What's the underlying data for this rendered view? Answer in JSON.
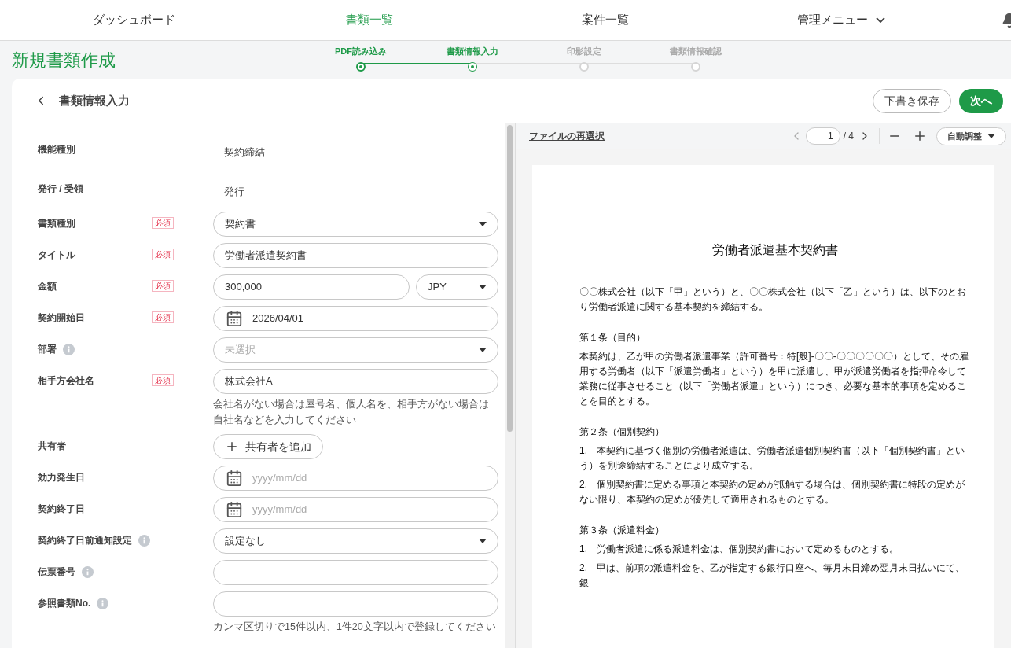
{
  "nav": {
    "items": [
      {
        "label": "ダッシュボード",
        "selected": false,
        "menu": false
      },
      {
        "label": "書類一覧",
        "selected": true,
        "menu": false
      },
      {
        "label": "案件一覧",
        "selected": false,
        "menu": false
      },
      {
        "label": "管理メニュー",
        "selected": false,
        "menu": true
      }
    ]
  },
  "page_title": "新規書類作成",
  "steps": [
    {
      "label": "PDF読み込み",
      "done": true,
      "selected": false
    },
    {
      "label": "書類情報入力",
      "done": false,
      "selected": true
    },
    {
      "label": "印影設定",
      "done": false,
      "selected": false
    },
    {
      "label": "書類情報確認",
      "done": false,
      "selected": false
    }
  ],
  "card": {
    "title": "書類情報入力",
    "buttons": [
      {
        "label": "下書き保存",
        "kind": "outline"
      },
      {
        "label": "次へ",
        "kind": "primary"
      }
    ]
  },
  "form": [
    {
      "kind": "static",
      "label": "機能種別",
      "info": false,
      "value": "契約締結"
    },
    {
      "kind": "static",
      "label": "発行 / 受領",
      "info": false,
      "value": "発行"
    },
    {
      "kind": "select",
      "label": "書類種別",
      "required_badge": "必須",
      "info": false,
      "value": "契約書"
    },
    {
      "kind": "text",
      "label": "タイトル",
      "required_badge": "必須",
      "info": false,
      "value": "労働者派遣契約書"
    },
    {
      "kind": "amount",
      "label": "金額",
      "required_badge": "必須",
      "info": false,
      "value": "300,000",
      "currency": "JPY"
    },
    {
      "kind": "date",
      "label": "契約開始日",
      "required_badge": "必須",
      "info": false,
      "value": "2026/04/01"
    },
    {
      "kind": "select",
      "label": "部署",
      "info": true,
      "placeholder": "未選択"
    },
    {
      "kind": "text",
      "label": "相手方会社名",
      "required_badge": "必須",
      "info": false,
      "value": "株式会社A",
      "note": "会社名がない場合は屋号名、個人名を、相手方がない場合は自社名などを入力してください"
    },
    {
      "kind": "button",
      "label": "共有者",
      "info": false,
      "button": "共有者を追加"
    },
    {
      "kind": "date",
      "label": "効力発生日",
      "info": false,
      "placeholder": "yyyy/mm/dd"
    },
    {
      "kind": "date",
      "label": "契約終了日",
      "info": false,
      "placeholder": "yyyy/mm/dd"
    },
    {
      "kind": "select",
      "label": "契約終了日前通知設定",
      "info": true,
      "value": "設定なし"
    },
    {
      "kind": "text",
      "label": "伝票番号",
      "info": true
    },
    {
      "kind": "text",
      "label": "参照書類No.",
      "info": true,
      "note": "カンマ区切りで15件以内、1件20文字以内で登録してください"
    }
  ],
  "viewer": {
    "reselect": "ファイルの再選択",
    "page": "1",
    "total": "/ 4",
    "zoom": "自動調整",
    "document": [
      {
        "kind": "title",
        "text": "労働者派遣基本契約書"
      },
      {
        "kind": "para",
        "text": "〇〇株式会社（以下「甲」という）と、〇〇株式会社（以下「乙」という）は、以下のとおり労働者派遣に関する基本契約を締結する。"
      },
      {
        "kind": "heading",
        "text": "第１条（目的）"
      },
      {
        "kind": "para",
        "text": "本契約は、乙が甲の労働者派遣事業（許可番号：特[般]-〇〇-〇〇〇〇〇〇）として、その雇用する労働者（以下「派遣労働者」という）を甲に派遣し、甲が派遣労働者を指揮命令して業務に従事させること（以下「労働者派遣」という）につき、必要な基本的事項を定めることを目的とする。"
      },
      {
        "kind": "heading",
        "text": "第２条（個別契約）"
      },
      {
        "kind": "para",
        "text": "1.　本契約に基づく個別の労働者派遣は、労働者派遣個別契約書（以下「個別契約書」という）を別途締結することにより成立する。"
      },
      {
        "kind": "para",
        "text": "2.　個別契約書に定める事項と本契約の定めが抵触する場合は、個別契約書に特段の定めがない限り、本契約の定めが優先して適用されるものとする。"
      },
      {
        "kind": "heading",
        "text": "第３条（派遣料金）"
      },
      {
        "kind": "para",
        "text": "1.　労働者派遣に係る派遣料金は、個別契約書において定めるものとする。"
      },
      {
        "kind": "para",
        "text": "2.　甲は、前項の派遣料金を、乙が指定する銀行口座へ、毎月末日締め翌月末日払いにて、銀"
      }
    ]
  }
}
